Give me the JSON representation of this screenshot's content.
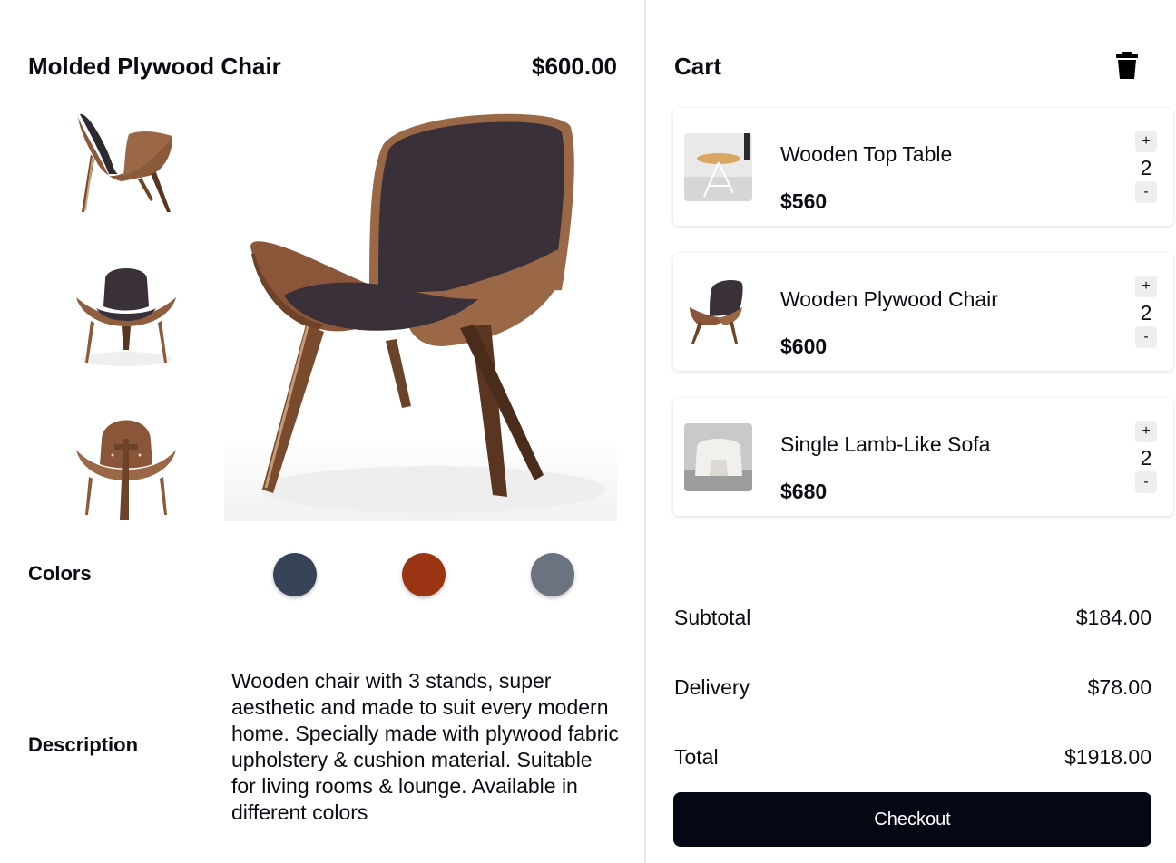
{
  "product": {
    "title": "Molded Plywood Chair",
    "price": "$600.00",
    "colors_label": "Colors",
    "colors": [
      "#374357",
      "#9a3412",
      "#6b7280"
    ],
    "description_label": "Description",
    "description": "Wooden chair with 3 stands, super aesthetic and made to suit every modern home. Specially made with plywood fabric upholstery & cushion material. Suitable for living rooms & lounge. Available in different colors"
  },
  "cart": {
    "title": "Cart",
    "clear_icon": "trash-icon",
    "items": [
      {
        "name": "Wooden Top Table",
        "price": "$560",
        "quantity": "2",
        "plus": "+",
        "minus": "-"
      },
      {
        "name": "Wooden Plywood Chair",
        "price": "$600",
        "quantity": "2",
        "plus": "+",
        "minus": "-"
      },
      {
        "name": "Single Lamb-Like Sofa",
        "price": "$680",
        "quantity": "2",
        "plus": "+",
        "minus": "-"
      }
    ],
    "summary": {
      "subtotal_label": "Subtotal",
      "subtotal": "$184.00",
      "delivery_label": "Delivery",
      "delivery": "$78.00",
      "total_label": "Total",
      "total": "$1918.00"
    },
    "checkout_label": "Checkout"
  }
}
